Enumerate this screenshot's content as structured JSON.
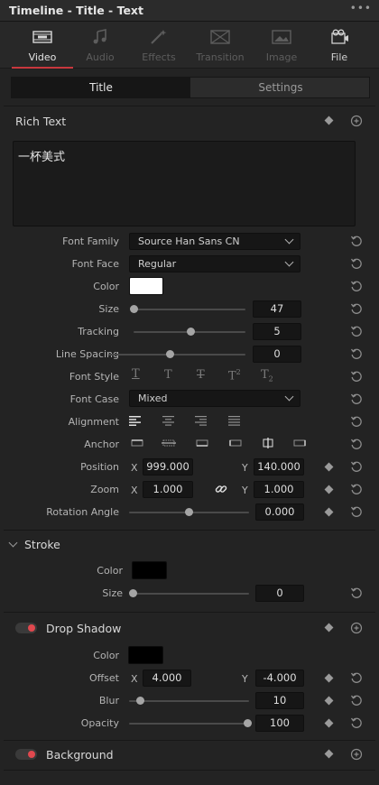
{
  "window": {
    "title": "Timeline - Title - Text",
    "menu_icon": "ellipsis-icon"
  },
  "tabs": [
    {
      "label": "Video",
      "icon": "video-icon",
      "state": "active"
    },
    {
      "label": "Audio",
      "icon": "audio-icon",
      "state": "disabled"
    },
    {
      "label": "Effects",
      "icon": "effects-icon",
      "state": "disabled"
    },
    {
      "label": "Transition",
      "icon": "transition-icon",
      "state": "disabled"
    },
    {
      "label": "Image",
      "icon": "image-icon",
      "state": "disabled"
    },
    {
      "label": "File",
      "icon": "file-icon",
      "state": "enabled"
    }
  ],
  "subtabs": [
    {
      "label": "Title",
      "active": true
    },
    {
      "label": "Settings",
      "active": false
    }
  ],
  "rich_text": {
    "heading": "Rich Text",
    "content": "一杯美式"
  },
  "properties": {
    "font_family": {
      "label": "Font Family",
      "value": "Source Han Sans CN"
    },
    "font_face": {
      "label": "Font Face",
      "value": "Regular"
    },
    "color": {
      "label": "Color",
      "value": "#ffffff"
    },
    "size": {
      "label": "Size",
      "value": "47",
      "slider_fraction": 0.0
    },
    "tracking": {
      "label": "Tracking",
      "value": "5",
      "slider_fraction": 0.5
    },
    "line_spacing": {
      "label": "Line Spacing",
      "value": "0",
      "slider_fraction": 0.5
    },
    "font_style": {
      "label": "Font Style",
      "options": [
        "T",
        "T",
        "T",
        "T2",
        "T2"
      ]
    },
    "font_case": {
      "label": "Font Case",
      "value": "Mixed"
    },
    "alignment": {
      "label": "Alignment",
      "options": [
        "align-left-icon",
        "align-center-icon",
        "align-right-icon",
        "align-justify-icon"
      ],
      "selected": 0
    },
    "anchor": {
      "label": "Anchor",
      "options": [
        "anchor-1-icon",
        "anchor-2-icon",
        "anchor-3-icon",
        "anchor-4-icon",
        "anchor-5-icon",
        "anchor-6-icon"
      ],
      "selected": 4
    },
    "position": {
      "label": "Position",
      "x_label": "X",
      "x": "999.000",
      "y_label": "Y",
      "y": "140.000"
    },
    "zoom": {
      "label": "Zoom",
      "x_label": "X",
      "x": "1.000",
      "y_label": "Y",
      "y": "1.000",
      "link_icon": "link-icon"
    },
    "rotation_angle": {
      "label": "Rotation Angle",
      "value": "0.000",
      "slider_fraction": 0.5
    }
  },
  "stroke": {
    "heading": "Stroke",
    "color_label": "Color",
    "color": "#000000",
    "size_label": "Size",
    "size": "0",
    "slider_fraction": 0.0
  },
  "drop_shadow": {
    "heading": "Drop Shadow",
    "enabled": true,
    "color_label": "Color",
    "color": "#000000",
    "offset_label": "Offset",
    "offset_x_label": "X",
    "offset_x": "4.000",
    "offset_y_label": "Y",
    "offset_y": "-4.000",
    "blur_label": "Blur",
    "blur": "10",
    "blur_fraction": 0.08,
    "opacity_label": "Opacity",
    "opacity": "100",
    "opacity_fraction": 1.0
  },
  "background": {
    "heading": "Background",
    "enabled": true
  },
  "colors": {
    "accent": "#c8373d",
    "panel": "#232323",
    "field": "#161616",
    "toggle_on": "#e0484e"
  }
}
